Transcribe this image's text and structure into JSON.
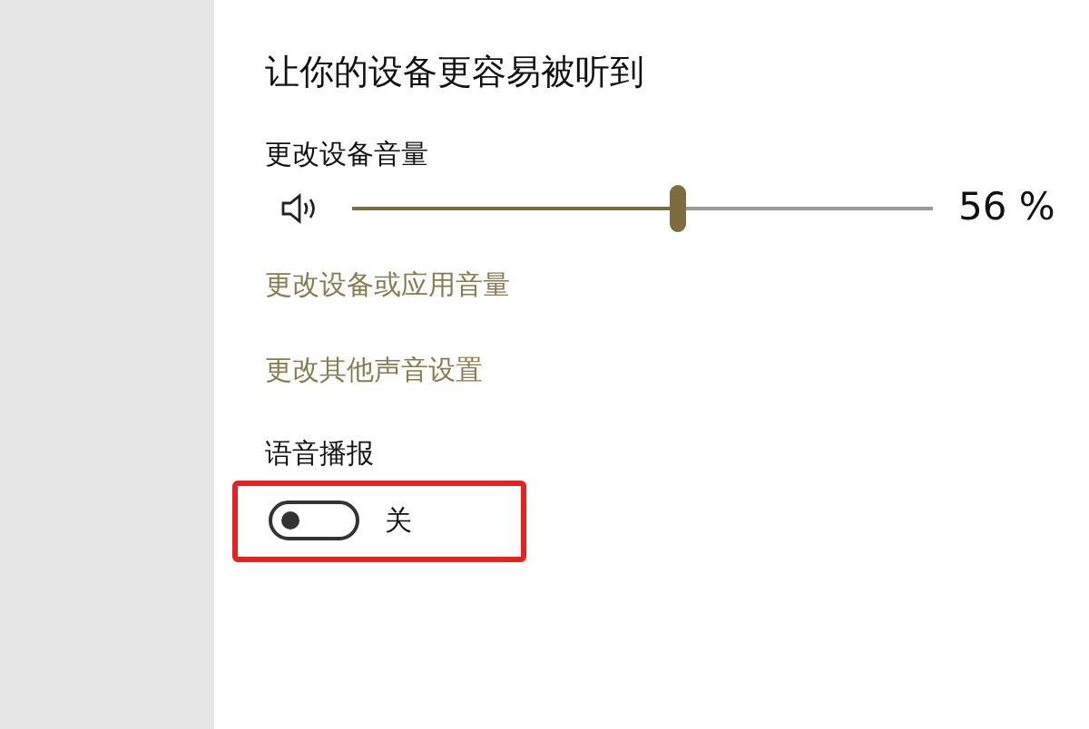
{
  "section": {
    "title": "让你的设备更容易被听到"
  },
  "volume": {
    "label": "更改设备音量",
    "level": 0.56,
    "reading": "56 %"
  },
  "links": [
    "更改设备或应用音量",
    "更改其他声音设置"
  ],
  "narrator": {
    "label": "语音播报",
    "on": false,
    "state_text": "关",
    "highlighted": true
  }
}
